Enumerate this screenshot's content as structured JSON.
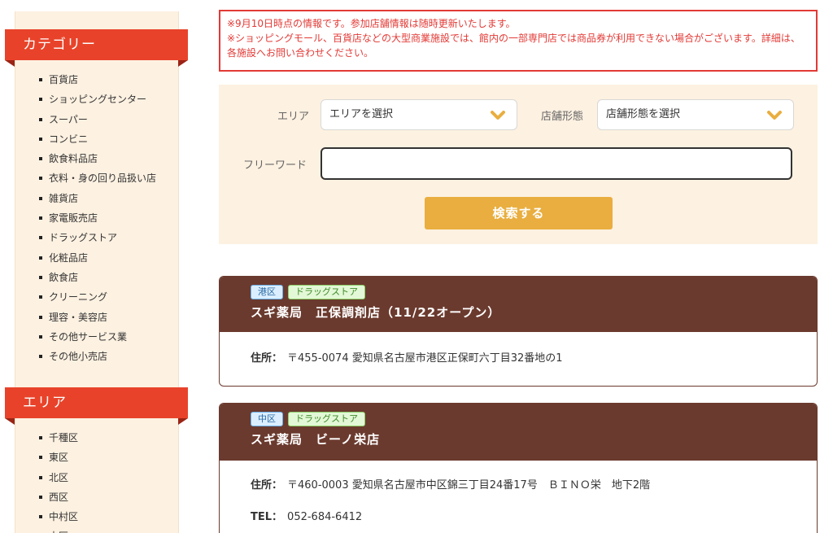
{
  "sidebar": {
    "category_title": "カテゴリー",
    "categories": [
      "百貨店",
      "ショッピングセンター",
      "スーパー",
      "コンビニ",
      "飲食料品店",
      "衣料・身の回り品扱い店",
      "雑貨店",
      "家電販売店",
      "ドラッグストア",
      "化粧品店",
      "飲食店",
      "クリーニング",
      "理容・美容店",
      "その他サービス業",
      "その他小売店"
    ],
    "area_title": "エリア",
    "areas": [
      "千種区",
      "東区",
      "北区",
      "西区",
      "中村区",
      "中区"
    ]
  },
  "notice": {
    "line1": "※9月10日時点の情報です。参加店舗情報は随時更新いたします。",
    "line2": "※ショッピングモール、百貨店などの大型商業施設では、館内の一部専門店では商品券が利用できない場合がございます。詳細は、各施設へお問い合わせください。"
  },
  "search": {
    "area_label": "エリア",
    "area_value": "エリアを選択",
    "type_label": "店舗形態",
    "type_value": "店舗形態を選択",
    "freeword_label": "フリーワード",
    "freeword_value": "",
    "submit_label": "検索する"
  },
  "stores": [
    {
      "area": "港区",
      "type": "ドラッグストア",
      "name": "スギ薬局　正保調剤店（11/22オープン）",
      "address_label": "住所：",
      "address": "〒455-0074 愛知県名古屋市港区正保町六丁目32番地の1"
    },
    {
      "area": "中区",
      "type": "ドラッグストア",
      "name": "スギ薬局　ビーノ栄店",
      "address_label": "住所：",
      "address": "〒460-0003 愛知県名古屋市中区錦三丁目24番17号　ＢＩＮＯ栄　地下2階",
      "tel_label": "TEL：",
      "tel": "052-684-6412"
    }
  ],
  "colors": {
    "accent": "#e8432a",
    "card": "#6b3a2e",
    "button": "#e9ae3f",
    "panel": "#fdf1e1"
  },
  "icons": {
    "dropdown": "chevron-down-icon"
  }
}
